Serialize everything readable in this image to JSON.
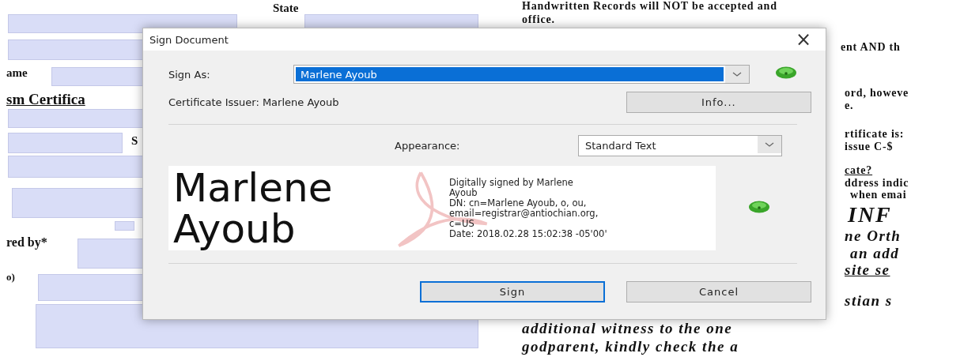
{
  "document": {
    "left_labels": [
      "State",
      "ame",
      "sm Certifica",
      "S",
      "red by*",
      "o)"
    ],
    "right_lines": [
      {
        "text": "Handwritten Records will NOT be accepted and",
        "kind": "text"
      },
      {
        "text": "office.",
        "kind": "text"
      },
      {
        "text": "ent AND th",
        "kind": "text"
      },
      {
        "text": "ord, howeve",
        "kind": "text"
      },
      {
        "text": "e.",
        "kind": "text"
      },
      {
        "text": "rtificate is:",
        "kind": "text"
      },
      {
        "text": "issue   C-$",
        "kind": "text"
      },
      {
        "text": "cate?",
        "kind": "link"
      },
      {
        "text": "ddress indic",
        "kind": "text"
      },
      {
        "text": "when emai",
        "kind": "text"
      },
      {
        "text": "INF",
        "kind": "heading"
      },
      {
        "text": "ne Orth",
        "kind": "emphasis"
      },
      {
        "text": "an add",
        "kind": "emphasis"
      },
      {
        "text": "site se",
        "kind": "emphasis-link"
      },
      {
        "text": "stian s",
        "kind": "emphasis"
      },
      {
        "text": "additional witness to the one",
        "kind": "emphasis"
      },
      {
        "text": "godparent, kindly check the a",
        "kind": "emphasis"
      }
    ]
  },
  "dialog": {
    "title": "Sign Document",
    "close": "×",
    "sign_as": {
      "label": "Sign As:",
      "value": "Marlene Ayoub",
      "selected": true
    },
    "issuer": "Certificate Issuer: Marlene Ayoub",
    "info_button": "Info...",
    "appearance": {
      "label": "Appearance:",
      "value": "Standard Text"
    },
    "preview": {
      "name_lines": [
        "Marlene",
        "Ayoub"
      ],
      "details": [
        "Digitally signed by Marlene",
        "Ayoub",
        "DN: cn=Marlene Ayoub, o, ou,",
        "email=registrar@antiochian.org,",
        "c=US",
        "Date: 2018.02.28 15:02:38 -05'00'"
      ]
    },
    "buttons": [
      {
        "label": "Sign",
        "default": true
      },
      {
        "label": "Cancel",
        "default": false
      }
    ]
  }
}
